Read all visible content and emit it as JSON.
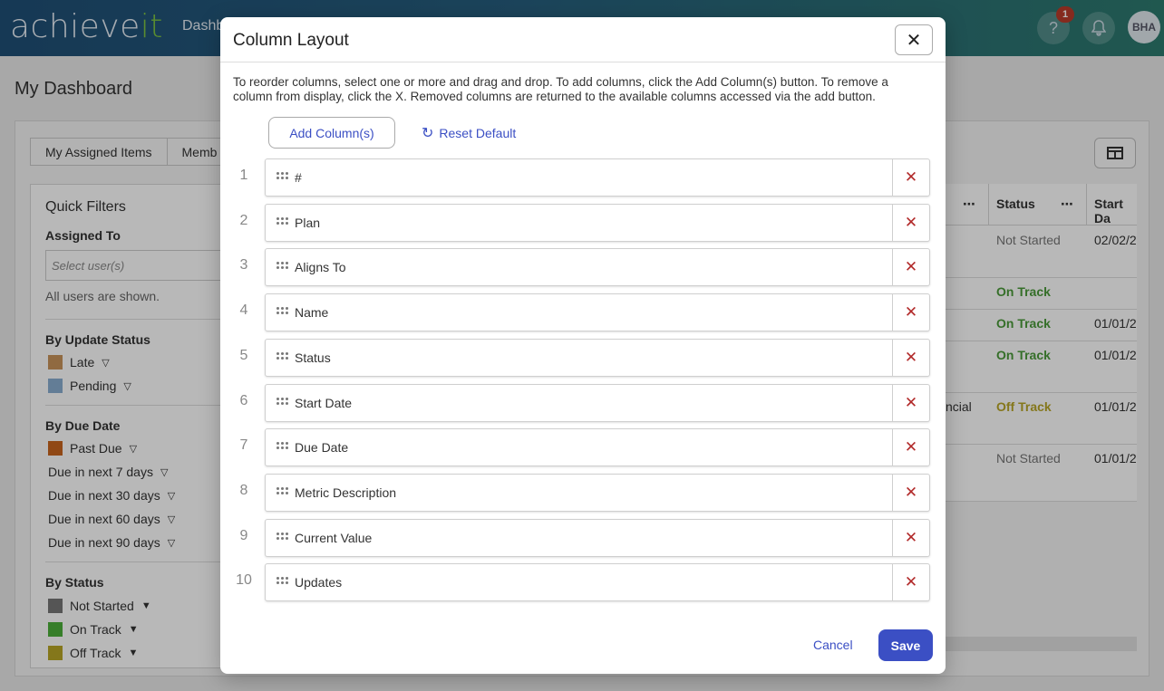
{
  "app": {
    "logo_main": "achieve",
    "logo_accent": "it",
    "nav_partial": "Dashb",
    "notification_count": "1",
    "help_glyph": "?",
    "bell_glyph": "🔔",
    "user_initials": "BHA"
  },
  "page": {
    "title": "My Dashboard",
    "tabs": [
      "My Assigned Items",
      "Memb"
    ]
  },
  "quick_filters": {
    "title": "Quick Filters",
    "assigned_to_label": "Assigned To",
    "select_placeholder": "Select user(s)",
    "all_users_note": "All users are shown.",
    "update_status_label": "By Update Status",
    "update_status_items": [
      {
        "label": "Late",
        "color": "#c8935a"
      },
      {
        "label": "Pending",
        "color": "#8aaed0"
      }
    ],
    "due_date_label": "By Due Date",
    "due_date_items": [
      {
        "label": "Past Due",
        "color": "#c8651e"
      },
      {
        "label": "Due in next 7 days"
      },
      {
        "label": "Due in next 30 days"
      },
      {
        "label": "Due in next 60 days"
      },
      {
        "label": "Due in next 90 days"
      }
    ],
    "status_label": "By Status",
    "status_items": [
      {
        "label": "Not Started",
        "color": "#777777"
      },
      {
        "label": "On Track",
        "color": "#4caf3a"
      },
      {
        "label": "Off Track",
        "color": "#b8a526"
      }
    ]
  },
  "grid": {
    "headers": [
      "Status",
      "Start Da"
    ],
    "more_glyph": "⋯",
    "rows": [
      {
        "status": "Not Started",
        "start": "02/02/2",
        "status_color": "#777777"
      },
      {
        "status": "On Track",
        "start": "",
        "status_color": "#4a9a3a"
      },
      {
        "status": "On Track",
        "start": "01/01/2",
        "status_color": "#4a9a3a"
      },
      {
        "status": "On Track",
        "start": "01/01/2",
        "status_color": "#4a9a3a"
      },
      {
        "status": "Off Track",
        "start": "01/01/2",
        "status_color": "#b8a526",
        "partial": "ncial"
      },
      {
        "status": "Not Started",
        "start": "01/01/2",
        "status_color": "#777777"
      }
    ]
  },
  "dialog": {
    "title": "Column Layout",
    "close_glyph": "✕",
    "instructions": "To reorder columns, select one or more and drag and drop. To add columns, click the Add Column(s) button. To remove a column from display, click the X. Removed columns are returned to the available columns accessed via the add button.",
    "add_columns_label": "Add Column(s)",
    "reset_label": "Reset Default",
    "remove_glyph": "✕",
    "columns": [
      {
        "num": "1",
        "label": "#"
      },
      {
        "num": "2",
        "label": "Plan"
      },
      {
        "num": "3",
        "label": "Aligns To"
      },
      {
        "num": "4",
        "label": "Name"
      },
      {
        "num": "5",
        "label": "Status"
      },
      {
        "num": "6",
        "label": "Start Date"
      },
      {
        "num": "7",
        "label": "Due Date"
      },
      {
        "num": "8",
        "label": "Metric Description"
      },
      {
        "num": "9",
        "label": "Current Value"
      },
      {
        "num": "10",
        "label": "Updates"
      }
    ],
    "cancel_label": "Cancel",
    "save_label": "Save"
  }
}
